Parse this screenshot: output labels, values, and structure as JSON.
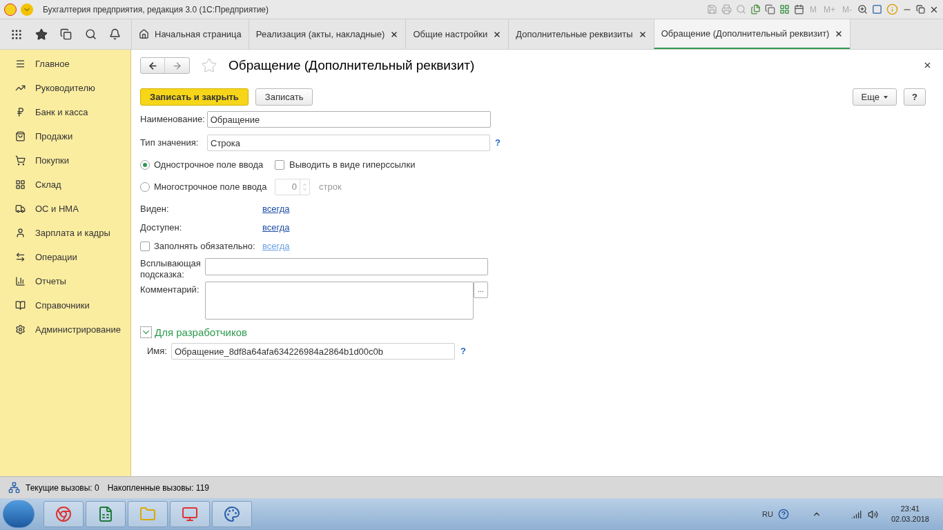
{
  "window": {
    "title": "Бухгалтерия предприятия, редакция 3.0  (1С:Предприятие)",
    "memory_buttons": [
      "M",
      "M+",
      "M-"
    ]
  },
  "tabs": [
    {
      "label": "Начальная страница",
      "kind": "home",
      "selected": false
    },
    {
      "label": "Реализация (акты, накладные)",
      "kind": "doc",
      "selected": false
    },
    {
      "label": "Общие настройки",
      "kind": "doc",
      "selected": false
    },
    {
      "label": "Дополнительные реквизиты",
      "kind": "doc",
      "selected": false
    },
    {
      "label": "Обращение (Дополнительный реквизит)",
      "kind": "doc",
      "selected": true
    }
  ],
  "sidebar": {
    "items": [
      {
        "label": "Главное",
        "kind": "menu"
      },
      {
        "label": "Руководителю",
        "kind": "trend"
      },
      {
        "label": "Банк и касса",
        "kind": "bank"
      },
      {
        "label": "Продажи",
        "kind": "bag"
      },
      {
        "label": "Покупки",
        "kind": "cart"
      },
      {
        "label": "Склад",
        "kind": "grid"
      },
      {
        "label": "ОС и НМА",
        "kind": "truck"
      },
      {
        "label": "Зарплата и кадры",
        "kind": "user"
      },
      {
        "label": "Операции",
        "kind": "ops"
      },
      {
        "label": "Отчеты",
        "kind": "chart"
      },
      {
        "label": "Справочники",
        "kind": "book"
      },
      {
        "label": "Администрирование",
        "kind": "gear"
      }
    ]
  },
  "form": {
    "title": "Обращение (Дополнительный реквизит)",
    "buttons": [
      {
        "label": "Записать и закрыть",
        "kind": "primary"
      },
      {
        "label": "Записать",
        "kind": "normal"
      }
    ],
    "more_button": "Еще",
    "help_button": "?",
    "name_field": {
      "label": "Наименование:",
      "value": "Обращение"
    },
    "type_field": {
      "label": "Тип значения:",
      "value": "Строка",
      "help": "?"
    },
    "input_modes": [
      {
        "label": "Однострочное поле ввода",
        "selected": true
      },
      {
        "label": "Многострочное поле ввода",
        "selected": false
      }
    ],
    "hyperlink_checkbox": {
      "label": "Выводить в виде гиперссылки",
      "checked": false
    },
    "lines_spinner": {
      "value": "0",
      "suffix": "строк",
      "disabled": true
    },
    "conditions": [
      {
        "label": "Виден:",
        "link": "всегда",
        "kind": "plain",
        "disabled": false
      },
      {
        "label": "Доступен:",
        "link": "всегда",
        "kind": "plain",
        "disabled": false
      },
      {
        "label": "Заполнять обязательно:",
        "link": "всегда",
        "kind": "checkbox",
        "checked": false,
        "disabled": true
      }
    ],
    "tooltip_field": {
      "label": "Всплывающая подсказка:"
    },
    "comment_field": {
      "label": "Комментарий:",
      "button": "..."
    },
    "developer_group": {
      "title": "Для разработчиков",
      "expanded": true,
      "name_label": "Имя:",
      "name_value": "Обращение_8df8a64afa634226984a2864b1d00c0b",
      "help": "?"
    }
  },
  "status_bar": {
    "current_calls": "Текущие вызовы: 0",
    "total_calls": "Накопленные вызовы: 119"
  },
  "taskbar": {
    "language": "RU",
    "time": "23:41",
    "date": "02.03.2018"
  }
}
